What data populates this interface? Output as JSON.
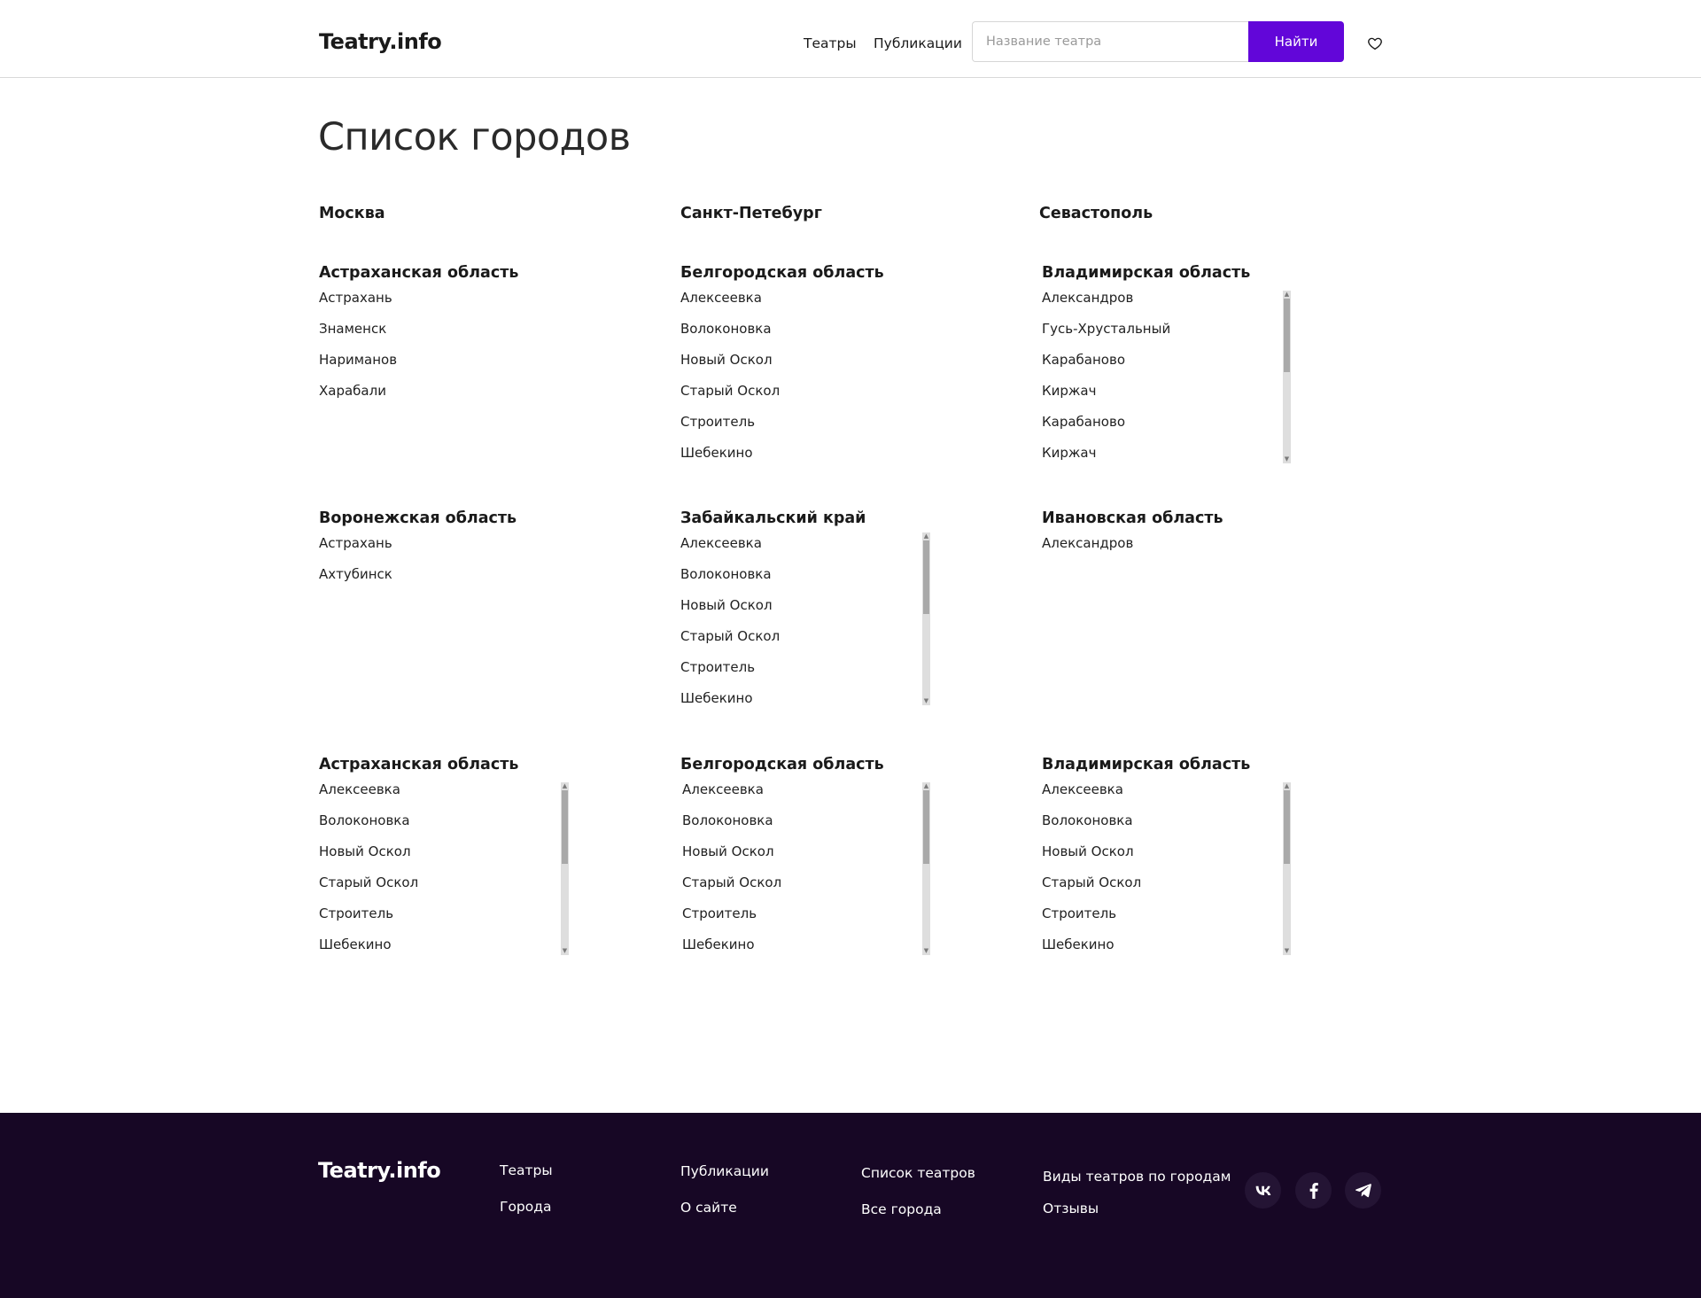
{
  "header": {
    "logo": "Teatry.info",
    "nav": [
      "Театры",
      "Публикации"
    ],
    "search_placeholder": "Название театра",
    "search_button": "Найти"
  },
  "page_title": "Список городов",
  "cities": [
    "Москва",
    "Санкт-Петебург",
    "Севастополь"
  ],
  "regions": [
    {
      "title": "Астраханская область",
      "items": [
        "Астрахань",
        "Знаменск",
        "Нариманов",
        "Харабали"
      ]
    },
    {
      "title": "Белгородская область",
      "items": [
        "Алексеевка",
        "Волоконовка",
        "Новый Оскол",
        "Старый Оскол",
        "Строитель",
        "Шебекино"
      ]
    },
    {
      "title": "Владимирская область",
      "items": [
        "Александров",
        "Гусь-Хрустальный",
        "Карабаново",
        "Киржач",
        "Карабаново",
        "Киржач"
      ]
    },
    {
      "title": "Воронежская область",
      "items": [
        "Астрахань",
        "Ахтубинск"
      ]
    },
    {
      "title": "Забайкальский край",
      "items": [
        "Алексеевка",
        "Волоконовка",
        "Новый Оскол",
        "Старый Оскол",
        "Строитель",
        "Шебекино"
      ]
    },
    {
      "title": "Ивановская область",
      "items": [
        "Александров"
      ]
    },
    {
      "title": "Астраханская область",
      "items": [
        "Алексеевка",
        "Волоконовка",
        "Новый Оскол",
        "Старый Оскол",
        "Строитель",
        "Шебекино"
      ]
    },
    {
      "title": "Белгородская область",
      "items": [
        "Алексеевка",
        "Волоконовка",
        "Новый Оскол",
        "Старый Оскол",
        "Строитель",
        "Шебекино"
      ]
    },
    {
      "title": "Владимирская область",
      "items": [
        "Алексеевка",
        "Волоконовка",
        "Новый Оскол",
        "Старый Оскол",
        "Строитель",
        "Шебекино"
      ]
    }
  ],
  "footer": {
    "logo": "Teatry.info",
    "links": [
      "Театры",
      "Города",
      "Публикации",
      "О сайте",
      "Список театров",
      "Все города",
      "Виды театров по городам",
      "Отзывы"
    ],
    "social": [
      "vk-icon",
      "facebook-icon",
      "telegram-icon"
    ]
  },
  "colors": {
    "accent": "#6206d9",
    "footer_bg": "#170725",
    "social_bg": "#241434"
  }
}
